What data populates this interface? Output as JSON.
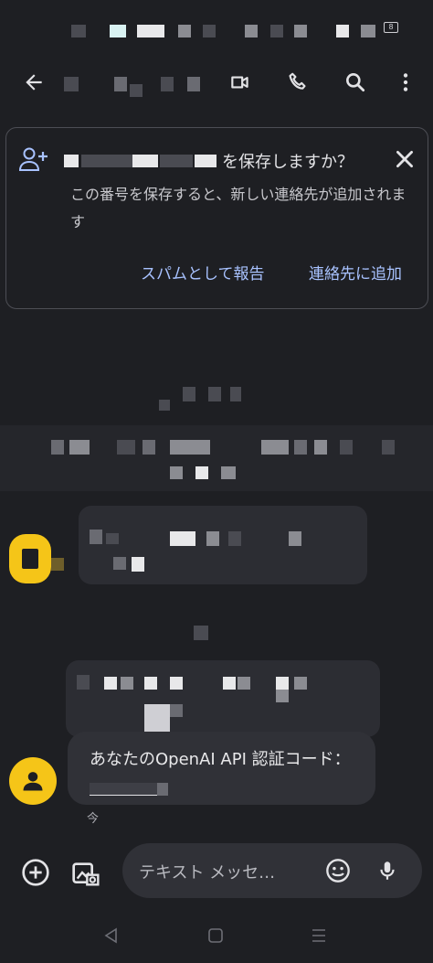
{
  "status_bar": {
    "battery": "8"
  },
  "app_bar": {
    "back_icon": "arrow-left-icon",
    "video_icon": "video-call-icon",
    "phone_icon": "phone-icon",
    "search_icon": "search-icon",
    "more_icon": "more-vert-icon"
  },
  "save_card": {
    "title_suffix": "を保存しますか？",
    "body": "この番号を保存すると、新しい連絡先が追加されます",
    "spam_label": "スパムとして報告",
    "add_label": "連絡先に追加"
  },
  "messages": [
    {
      "text": "あなたのOpenAI API 認証コード：",
      "time": "今"
    }
  ],
  "composer": {
    "placeholder": "テキスト メッセ…"
  },
  "colors": {
    "background": "#1e1f23",
    "accent": "#a8c2ff",
    "avatar": "#f5c518",
    "bubble": "#303137"
  }
}
